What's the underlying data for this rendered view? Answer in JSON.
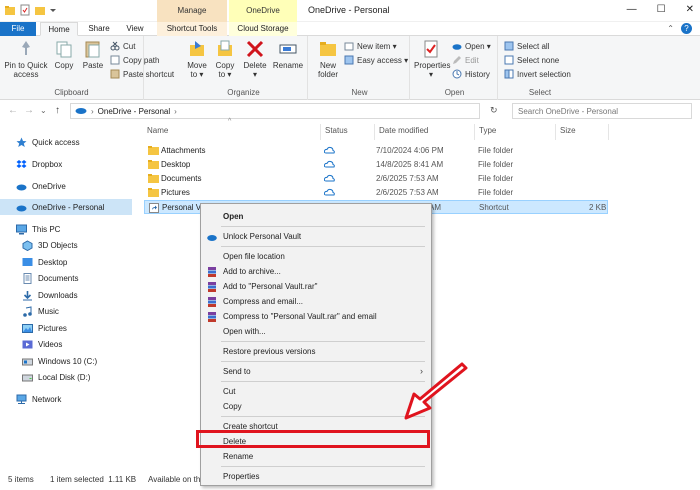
{
  "window": {
    "title": "OneDrive - Personal",
    "context_tab_manage": "Manage",
    "context_tab_onedrive": "OneDrive",
    "min_glyph": "—",
    "max_glyph": "☐",
    "close_glyph": "✕"
  },
  "ribbon_tabs": {
    "file": "File",
    "home": "Home",
    "share": "Share",
    "view": "View",
    "shortcut_tools": "Shortcut Tools",
    "cloud_storage": "Cloud Storage"
  },
  "ribbon": {
    "clipboard": {
      "label": "Clipboard",
      "pin_line1": "Pin to Quick",
      "pin_line2": "access",
      "copy": "Copy",
      "paste": "Paste",
      "cut": "Cut",
      "copy_path": "Copy path",
      "paste_shortcut": "Paste shortcut"
    },
    "organize": {
      "label": "Organize",
      "move_line1": "Move",
      "move_line2": "to ▾",
      "copy_line1": "Copy",
      "copy_line2": "to ▾",
      "delete": "Delete",
      "delete_caret": "▾",
      "rename": "Rename"
    },
    "new": {
      "label": "New",
      "new_folder_line1": "New",
      "new_folder_line2": "folder",
      "new_item": "New item ▾",
      "easy_access": "Easy access ▾"
    },
    "open": {
      "label": "Open",
      "properties": "Properties",
      "properties_caret": "▾",
      "open": "Open ▾",
      "edit": "Edit",
      "history": "History"
    },
    "select": {
      "label": "Select",
      "select_all": "Select all",
      "select_none": "Select none",
      "invert": "Invert selection"
    }
  },
  "address": {
    "back": "←",
    "forward": "→",
    "dropdown": "⌄",
    "up": "↑",
    "crumb_sep1": "›",
    "path": "OneDrive - Personal",
    "crumb_sep2": "›",
    "refresh": "↻",
    "search_placeholder": "Search OneDrive - Personal"
  },
  "sidebar": {
    "items": [
      {
        "label": "Quick access"
      },
      {
        "label": "Dropbox"
      },
      {
        "label": "OneDrive"
      },
      {
        "label": "OneDrive - Personal"
      },
      {
        "label": "This PC"
      },
      {
        "label": "3D Objects"
      },
      {
        "label": "Desktop"
      },
      {
        "label": "Documents"
      },
      {
        "label": "Downloads"
      },
      {
        "label": "Music"
      },
      {
        "label": "Pictures"
      },
      {
        "label": "Videos"
      },
      {
        "label": "Windows 10 (C:)"
      },
      {
        "label": "Local Disk (D:)"
      },
      {
        "label": "Network"
      }
    ]
  },
  "columns": {
    "name": "Name",
    "status": "Status",
    "date": "Date modified",
    "type": "Type",
    "size": "Size",
    "sort_caret": "^"
  },
  "files": [
    {
      "name": "Attachments",
      "date": "7/10/2024 4:06 PM",
      "type": "File folder",
      "size": ""
    },
    {
      "name": "Desktop",
      "date": "14/8/2025 8:41 AM",
      "type": "File folder",
      "size": ""
    },
    {
      "name": "Documents",
      "date": "2/6/2025 7:53 AM",
      "type": "File folder",
      "size": ""
    },
    {
      "name": "Pictures",
      "date": "2/6/2025 7:53 AM",
      "type": "File folder",
      "size": ""
    },
    {
      "name": "Personal V",
      "date": "AM",
      "type": "Shortcut",
      "size": "2 KB"
    }
  ],
  "status_bar": {
    "items": "5 items",
    "selected": "1 item selected  1.11 KB",
    "availability": "Available on thi"
  },
  "context_menu": {
    "open": "Open",
    "unlock": "Unlock Personal Vault",
    "open_location": "Open file location",
    "add_archive": "Add to archive...",
    "add_rar": "Add to \"Personal Vault.rar\"",
    "compress_email": "Compress and email...",
    "compress_rar_email": "Compress to \"Personal Vault.rar\" and email",
    "open_with": "Open with...",
    "restore": "Restore previous versions",
    "send_to": "Send to",
    "send_to_arrow": "›",
    "cut": "Cut",
    "copy": "Copy",
    "create_shortcut": "Create shortcut",
    "delete": "Delete",
    "rename": "Rename",
    "properties": "Properties"
  },
  "colors": {
    "accent": "#1a73c8",
    "selection": "#cce8ff",
    "highlight_red": "#e0141e"
  }
}
